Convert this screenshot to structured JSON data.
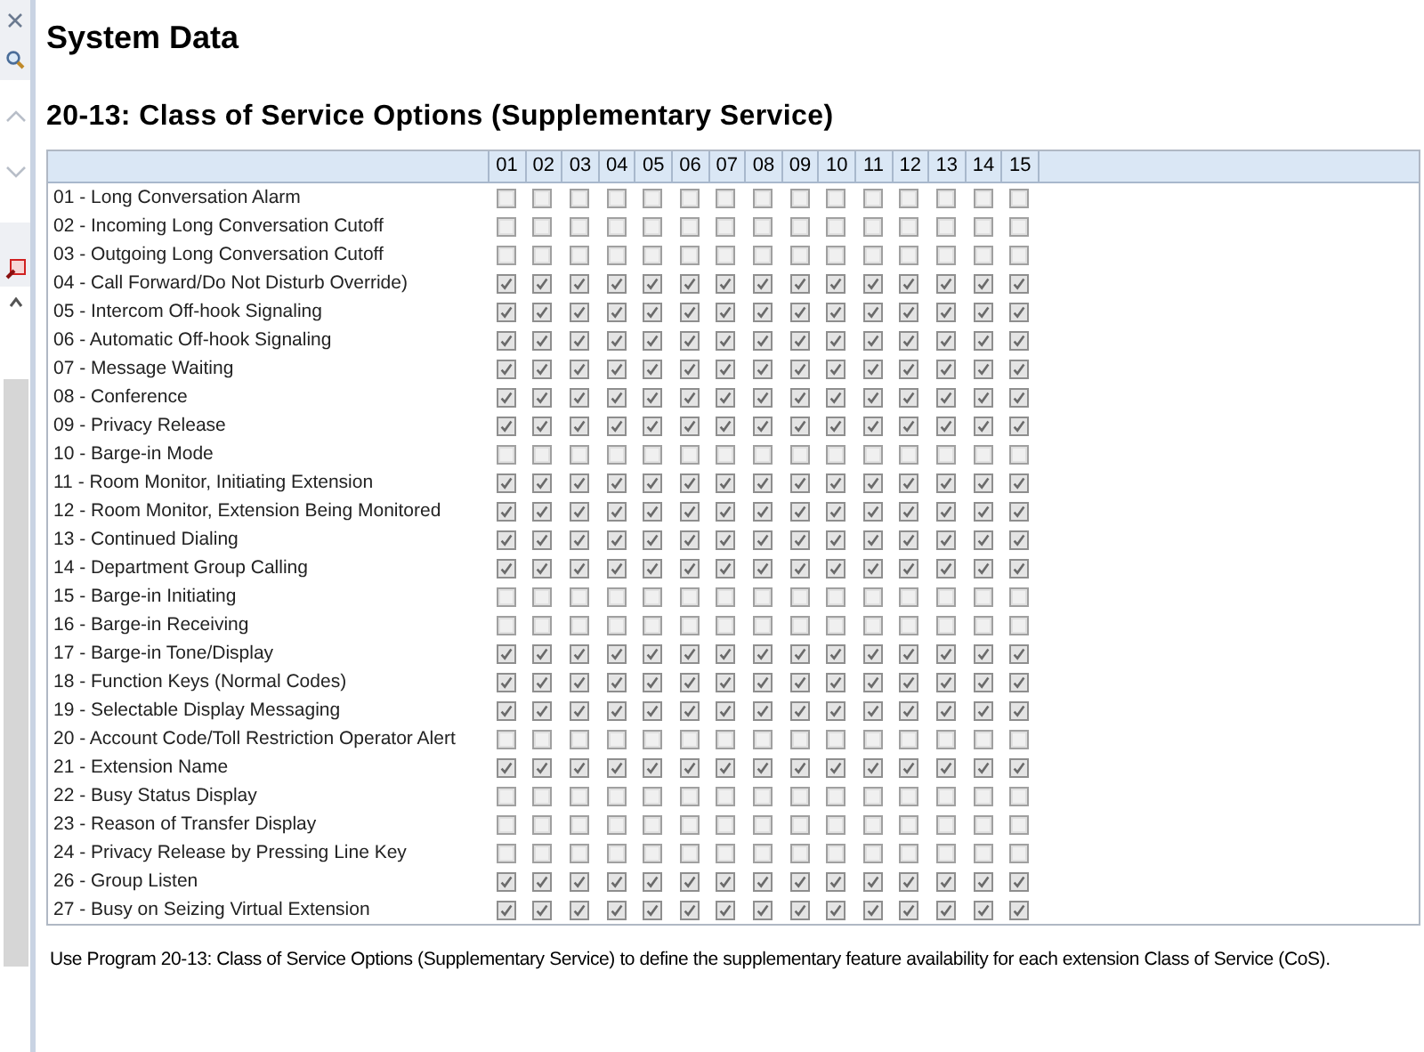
{
  "title": "System Data",
  "subtitle": "20-13: Class of Service Options (Supplementary Service)",
  "table": {
    "columns": [
      "01",
      "02",
      "03",
      "04",
      "05",
      "06",
      "07",
      "08",
      "09",
      "10",
      "11",
      "12",
      "13",
      "14",
      "15"
    ],
    "rows": [
      {
        "label": "01 - Long Conversation Alarm",
        "checks": [
          false,
          false,
          false,
          false,
          false,
          false,
          false,
          false,
          false,
          false,
          false,
          false,
          false,
          false,
          false
        ]
      },
      {
        "label": "02 - Incoming Long Conversation Cutoff",
        "checks": [
          false,
          false,
          false,
          false,
          false,
          false,
          false,
          false,
          false,
          false,
          false,
          false,
          false,
          false,
          false
        ]
      },
      {
        "label": "03 - Outgoing Long Conversation Cutoff",
        "checks": [
          false,
          false,
          false,
          false,
          false,
          false,
          false,
          false,
          false,
          false,
          false,
          false,
          false,
          false,
          false
        ]
      },
      {
        "label": "04 - Call Forward/Do Not Disturb Override)",
        "checks": [
          true,
          true,
          true,
          true,
          true,
          true,
          true,
          true,
          true,
          true,
          true,
          true,
          true,
          true,
          true
        ]
      },
      {
        "label": "05 - Intercom Off-hook Signaling",
        "checks": [
          true,
          true,
          true,
          true,
          true,
          true,
          true,
          true,
          true,
          true,
          true,
          true,
          true,
          true,
          true
        ]
      },
      {
        "label": "06 - Automatic Off-hook Signaling",
        "checks": [
          true,
          true,
          true,
          true,
          true,
          true,
          true,
          true,
          true,
          true,
          true,
          true,
          true,
          true,
          true
        ]
      },
      {
        "label": "07 - Message Waiting",
        "checks": [
          true,
          true,
          true,
          true,
          true,
          true,
          true,
          true,
          true,
          true,
          true,
          true,
          true,
          true,
          true
        ]
      },
      {
        "label": "08 - Conference",
        "checks": [
          true,
          true,
          true,
          true,
          true,
          true,
          true,
          true,
          true,
          true,
          true,
          true,
          true,
          true,
          true
        ]
      },
      {
        "label": "09 - Privacy Release",
        "checks": [
          true,
          true,
          true,
          true,
          true,
          true,
          true,
          true,
          true,
          true,
          true,
          true,
          true,
          true,
          true
        ]
      },
      {
        "label": "10 - Barge-in Mode",
        "checks": [
          false,
          false,
          false,
          false,
          false,
          false,
          false,
          false,
          false,
          false,
          false,
          false,
          false,
          false,
          false
        ]
      },
      {
        "label": "11 - Room Monitor, Initiating Extension",
        "checks": [
          true,
          true,
          true,
          true,
          true,
          true,
          true,
          true,
          true,
          true,
          true,
          true,
          true,
          true,
          true
        ]
      },
      {
        "label": "12 - Room Monitor, Extension Being Monitored",
        "checks": [
          true,
          true,
          true,
          true,
          true,
          true,
          true,
          true,
          true,
          true,
          true,
          true,
          true,
          true,
          true
        ]
      },
      {
        "label": "13 - Continued Dialing",
        "checks": [
          true,
          true,
          true,
          true,
          true,
          true,
          true,
          true,
          true,
          true,
          true,
          true,
          true,
          true,
          true
        ]
      },
      {
        "label": "14 - Department Group Calling",
        "checks": [
          true,
          true,
          true,
          true,
          true,
          true,
          true,
          true,
          true,
          true,
          true,
          true,
          true,
          true,
          true
        ]
      },
      {
        "label": "15 - Barge-in Initiating",
        "checks": [
          false,
          false,
          false,
          false,
          false,
          false,
          false,
          false,
          false,
          false,
          false,
          false,
          false,
          false,
          false
        ]
      },
      {
        "label": "16 - Barge-in Receiving",
        "checks": [
          false,
          false,
          false,
          false,
          false,
          false,
          false,
          false,
          false,
          false,
          false,
          false,
          false,
          false,
          false
        ]
      },
      {
        "label": "17 - Barge-in Tone/Display",
        "checks": [
          true,
          true,
          true,
          true,
          true,
          true,
          true,
          true,
          true,
          true,
          true,
          true,
          true,
          true,
          true
        ]
      },
      {
        "label": "18 - Function Keys (Normal Codes)",
        "checks": [
          true,
          true,
          true,
          true,
          true,
          true,
          true,
          true,
          true,
          true,
          true,
          true,
          true,
          true,
          true
        ]
      },
      {
        "label": "19 - Selectable Display Messaging",
        "checks": [
          true,
          true,
          true,
          true,
          true,
          true,
          true,
          true,
          true,
          true,
          true,
          true,
          true,
          true,
          true
        ]
      },
      {
        "label": "20 - Account Code/Toll Restriction Operator Alert",
        "checks": [
          false,
          false,
          false,
          false,
          false,
          false,
          false,
          false,
          false,
          false,
          false,
          false,
          false,
          false,
          false
        ]
      },
      {
        "label": "21 - Extension Name",
        "checks": [
          true,
          true,
          true,
          true,
          true,
          true,
          true,
          true,
          true,
          true,
          true,
          true,
          true,
          true,
          true
        ]
      },
      {
        "label": "22 - Busy Status Display",
        "checks": [
          false,
          false,
          false,
          false,
          false,
          false,
          false,
          false,
          false,
          false,
          false,
          false,
          false,
          false,
          false
        ]
      },
      {
        "label": "23 - Reason of Transfer Display",
        "checks": [
          false,
          false,
          false,
          false,
          false,
          false,
          false,
          false,
          false,
          false,
          false,
          false,
          false,
          false,
          false
        ]
      },
      {
        "label": "24 - Privacy Release by Pressing Line Key",
        "checks": [
          false,
          false,
          false,
          false,
          false,
          false,
          false,
          false,
          false,
          false,
          false,
          false,
          false,
          false,
          false
        ]
      },
      {
        "label": "26 - Group Listen",
        "checks": [
          true,
          true,
          true,
          true,
          true,
          true,
          true,
          true,
          true,
          true,
          true,
          true,
          true,
          true,
          true
        ]
      },
      {
        "label": "27 - Busy on Seizing Virtual Extension",
        "checks": [
          true,
          true,
          true,
          true,
          true,
          true,
          true,
          true,
          true,
          true,
          true,
          true,
          true,
          true,
          true
        ]
      }
    ]
  },
  "description": "Use Program 20-13: Class of Service Options (Supplementary Service) to define the supplementary feature availability for each extension Class of Service (CoS)."
}
